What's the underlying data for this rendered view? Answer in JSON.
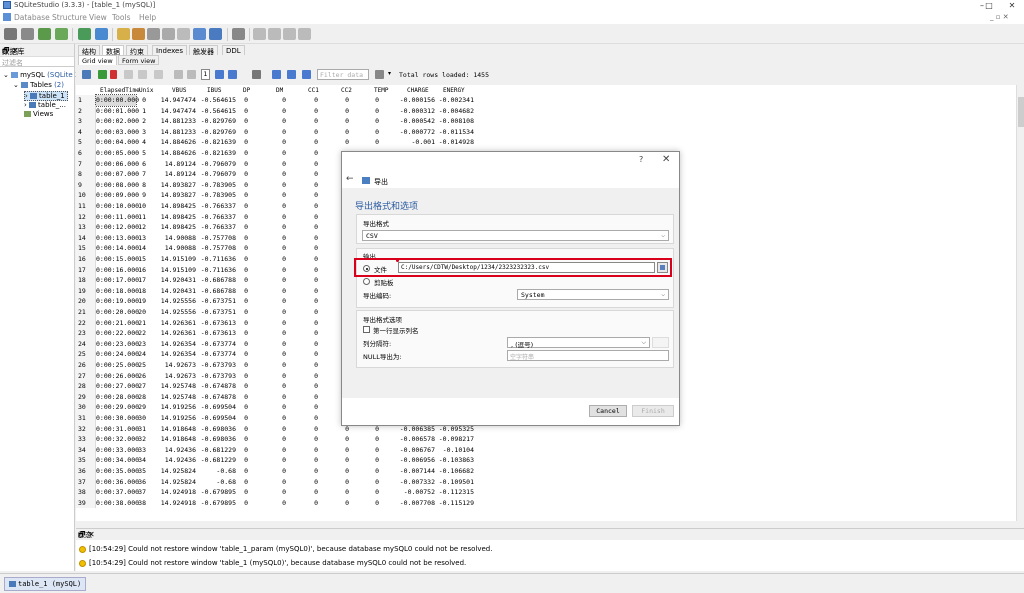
{
  "window": {
    "title": "SQLiteStudio (3.3.3) - [table_1 (mySQL)]",
    "min": "–",
    "max": "□",
    "close": "✕"
  },
  "menu": {
    "items": [
      "Database",
      "Structure",
      "View",
      "Tools",
      "Help"
    ],
    "mdi_controls": "_ ▫ ✕"
  },
  "left_panel": {
    "title": "数据库",
    "controls": "🗗 ✕",
    "filter_placeholder": "过滤名",
    "db_name": "mySQL",
    "db_type": "(SQLite 3)",
    "tables_label": "Tables",
    "tables_count": "(2)",
    "table1": "table_1",
    "table2": "table_...",
    "views_label": "Views"
  },
  "tabs": [
    "结构",
    "数据",
    "约束",
    "Indexes",
    "触发器",
    "DDL"
  ],
  "active_tab": "数据",
  "subtabs": [
    "Grid view",
    "Form view"
  ],
  "grid_toolbar": {
    "page_number": "1",
    "filter_placeholder": "Filter data",
    "total_rows": "Total rows loaded: 1455"
  },
  "grid": {
    "columns": [
      "ElapsedTime",
      "Unix",
      "VBUS",
      "IBUS",
      "DP",
      "DM",
      "CC1",
      "CC2",
      "TEMP",
      "CHARGE",
      "ENERGY"
    ],
    "rows": [
      [
        "0:00:00.000",
        "0",
        "14.947474",
        "-0.564615",
        "0",
        "0",
        "0",
        "0",
        "0",
        "-0.000156",
        "-0.002341"
      ],
      [
        "0:00:01.000",
        "1",
        "14.947474",
        "-0.564615",
        "0",
        "0",
        "0",
        "0",
        "0",
        "-0.000312",
        "-0.004682"
      ],
      [
        "0:00:02.000",
        "2",
        "14.881233",
        "-0.829769",
        "0",
        "0",
        "0",
        "0",
        "0",
        "-0.000542",
        "-0.008108"
      ],
      [
        "0:00:03.000",
        "3",
        "14.881233",
        "-0.829769",
        "0",
        "0",
        "0",
        "0",
        "0",
        "-0.000772",
        "-0.011534"
      ],
      [
        "0:00:04.000",
        "4",
        "14.884626",
        "-0.821639",
        "0",
        "0",
        "0",
        "0",
        "0",
        "-0.001",
        "-0.014928"
      ],
      [
        "0:00:05.000",
        "5",
        "14.884626",
        "-0.821639",
        "0",
        "0",
        "0",
        "",
        "",
        "",
        ""
      ],
      [
        "0:00:06.000",
        "6",
        "14.89124",
        "-0.796079",
        "0",
        "0",
        "0",
        "",
        "",
        "",
        ""
      ],
      [
        "0:00:07.000",
        "7",
        "14.89124",
        "-0.796079",
        "0",
        "0",
        "0",
        "",
        "",
        "",
        ""
      ],
      [
        "0:00:08.000",
        "8",
        "14.893827",
        "-0.783905",
        "0",
        "0",
        "0",
        "",
        "",
        "",
        ""
      ],
      [
        "0:00:09.000",
        "9",
        "14.893827",
        "-0.783905",
        "0",
        "0",
        "0",
        "",
        "",
        "",
        ""
      ],
      [
        "0:00:10.000",
        "10",
        "14.898425",
        "-0.766337",
        "0",
        "0",
        "0",
        "",
        "",
        "",
        ""
      ],
      [
        "0:00:11.000",
        "11",
        "14.898425",
        "-0.766337",
        "0",
        "0",
        "0",
        "",
        "",
        "",
        ""
      ],
      [
        "0:00:12.000",
        "12",
        "14.898425",
        "-0.766337",
        "0",
        "0",
        "0",
        "",
        "",
        "",
        ""
      ],
      [
        "0:00:13.000",
        "13",
        "14.90088",
        "-0.757708",
        "0",
        "0",
        "0",
        "",
        "",
        "",
        ""
      ],
      [
        "0:00:14.000",
        "14",
        "14.90088",
        "-0.757708",
        "0",
        "0",
        "0",
        "",
        "",
        "",
        ""
      ],
      [
        "0:00:15.000",
        "15",
        "14.915109",
        "-0.711636",
        "0",
        "0",
        "0",
        "",
        "",
        "",
        ""
      ],
      [
        "0:00:16.000",
        "16",
        "14.915109",
        "-0.711636",
        "0",
        "0",
        "0",
        "",
        "",
        "",
        ""
      ],
      [
        "0:00:17.000",
        "17",
        "14.920431",
        "-0.686788",
        "0",
        "0",
        "0",
        "",
        "",
        "",
        ""
      ],
      [
        "0:00:18.000",
        "18",
        "14.920431",
        "-0.686788",
        "0",
        "0",
        "0",
        "",
        "",
        "",
        ""
      ],
      [
        "0:00:19.000",
        "19",
        "14.925556",
        "-0.673751",
        "0",
        "0",
        "0",
        "",
        "",
        "",
        ""
      ],
      [
        "0:00:20.000",
        "20",
        "14.925556",
        "-0.673751",
        "0",
        "0",
        "0",
        "",
        "",
        "",
        ""
      ],
      [
        "0:00:21.000",
        "21",
        "14.926361",
        "-0.673613",
        "0",
        "0",
        "0",
        "",
        "",
        "",
        ""
      ],
      [
        "0:00:22.000",
        "22",
        "14.926361",
        "-0.673613",
        "0",
        "0",
        "0",
        "",
        "",
        "",
        ""
      ],
      [
        "0:00:23.000",
        "23",
        "14.926354",
        "-0.673774",
        "0",
        "0",
        "0",
        "",
        "",
        "",
        ""
      ],
      [
        "0:00:24.000",
        "24",
        "14.926354",
        "-0.673774",
        "0",
        "0",
        "0",
        "",
        "",
        "",
        ""
      ],
      [
        "0:00:25.000",
        "25",
        "14.92673",
        "-0.673793",
        "0",
        "0",
        "0",
        "",
        "",
        "",
        ""
      ],
      [
        "0:00:26.000",
        "26",
        "14.92673",
        "-0.673793",
        "0",
        "0",
        "0",
        "",
        "",
        "",
        ""
      ],
      [
        "0:00:27.000",
        "27",
        "14.925748",
        "-0.674878",
        "0",
        "0",
        "0",
        "",
        "",
        "",
        ""
      ],
      [
        "0:00:28.000",
        "28",
        "14.925748",
        "-0.674878",
        "0",
        "0",
        "0",
        "",
        "",
        "",
        ""
      ],
      [
        "0:00:29.000",
        "29",
        "14.919256",
        "-0.699504",
        "0",
        "0",
        "0",
        "",
        "",
        "",
        ""
      ],
      [
        "0:00:30.000",
        "30",
        "14.919256",
        "-0.699504",
        "0",
        "0",
        "0",
        "0",
        "0",
        "-0.006192",
        "-0.092433"
      ],
      [
        "0:00:31.000",
        "31",
        "14.918648",
        "-0.698036",
        "0",
        "0",
        "0",
        "0",
        "0",
        "-0.006385",
        "-0.095325"
      ],
      [
        "0:00:32.000",
        "32",
        "14.918648",
        "-0.698036",
        "0",
        "0",
        "0",
        "0",
        "0",
        "-0.006578",
        "-0.098217"
      ],
      [
        "0:00:33.000",
        "33",
        "14.92436",
        "-0.681229",
        "0",
        "0",
        "0",
        "0",
        "0",
        "-0.006767",
        "-0.10104"
      ],
      [
        "0:00:34.000",
        "34",
        "14.92436",
        "-0.681229",
        "0",
        "0",
        "0",
        "0",
        "0",
        "-0.006956",
        "-0.103863"
      ],
      [
        "0:00:35.000",
        "35",
        "14.925824",
        "-0.68",
        "0",
        "0",
        "0",
        "0",
        "0",
        "-0.007144",
        "-0.106682"
      ],
      [
        "0:00:36.000",
        "36",
        "14.925824",
        "-0.68",
        "0",
        "0",
        "0",
        "0",
        "0",
        "-0.007332",
        "-0.109501"
      ],
      [
        "0:00:37.000",
        "37",
        "14.924918",
        "-0.679895",
        "0",
        "0",
        "0",
        "0",
        "0",
        "-0.00752",
        "-0.112315"
      ],
      [
        "0:00:38.000",
        "38",
        "14.924918",
        "-0.679895",
        "0",
        "0",
        "0",
        "0",
        "0",
        "-0.007708",
        "-0.115129"
      ]
    ]
  },
  "status": {
    "title": "状态",
    "controls": "🗗 ✕",
    "messages": [
      "[10:54:29] Could not restore window 'table_1_param (mySQL0)', because database mySQL0 could not be resolved.",
      "[10:54:29] Could not restore window 'table_1 (mySQL0)', because database mySQL0 could not be resolved."
    ]
  },
  "taskbar": {
    "tab": "table_1 (mySQL)"
  },
  "dialog": {
    "help": "?",
    "close": "✕",
    "back": "←",
    "title": "导出",
    "heading": "导出格式和选项",
    "format_group": "导出格式",
    "format_value": "CSV",
    "output_label": "输出",
    "file_radio": "文件",
    "file_path": "C:/Users/CDTW/Desktop/1234/2323232323.csv",
    "clipboard_radio": "剪贴板",
    "encoding_label": "导出编码:",
    "encoding_value": "System",
    "options_group": "导出格式选项",
    "first_row_label": "第一行显示列名",
    "separator_label": "列分隔符:",
    "separator_value": ", (逗号)",
    "null_label": "NULL导出为:",
    "null_placeholder": "空字符串",
    "cancel_button": "Cancel",
    "finish_button": "Finish",
    "arrow": "⌵"
  }
}
